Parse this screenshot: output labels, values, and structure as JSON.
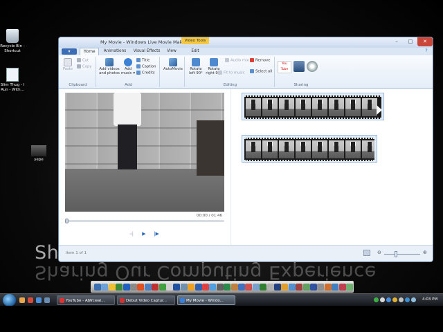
{
  "desktop": {
    "wallpaper_text": "Sharing Our Computing Experience",
    "icons": [
      {
        "label": "Recycle Bin - Shortcut"
      },
      {
        "label": "Slim Thug - I Run - With..."
      },
      {
        "label": "yepe"
      }
    ]
  },
  "window": {
    "title": "My Movie - Windows Live Movie Maker",
    "contextual_tab": "Video Tools",
    "controls": {
      "minimize": "–",
      "maximize": "□",
      "close": "✕"
    },
    "tabs": [
      {
        "label": "Home"
      },
      {
        "label": "Animations"
      },
      {
        "label": "Visual Effects"
      },
      {
        "label": "View"
      },
      {
        "label": "Edit"
      }
    ],
    "help": "?"
  },
  "ribbon": {
    "clipboard": {
      "label": "Clipboard",
      "paste": "Paste",
      "cut": "Cut",
      "copy": "Copy"
    },
    "add": {
      "label": "Add",
      "add_videos": "Add videos and photos",
      "add_music": "Add music ▾",
      "title": "Title",
      "caption": "Caption",
      "credits": "Credits"
    },
    "automovie": {
      "label": "AutoMovie"
    },
    "editing": {
      "label": "Editing",
      "rotate_left": "Rotate left 90°",
      "rotate_right": "Rotate right 90°",
      "audio_mix": "Audio mix",
      "fit_to_music": "Fit to music",
      "remove": "Remove",
      "select_all": "Select all"
    },
    "sharing": {
      "label": "Sharing",
      "youtube": "You Tube"
    }
  },
  "player": {
    "timecode": "00:00 / 01:46",
    "progress": 0
  },
  "status": {
    "item_text": "Item 1 of 1"
  },
  "taskbar": {
    "tasks": [
      {
        "label": "YouTube - AJWcwal...",
        "color": "#d33"
      },
      {
        "label": "Debut Video Captur...",
        "color": "#c33"
      },
      {
        "label": "My Movie - Windo...",
        "color": "#3a7fd5"
      }
    ],
    "clock": "4:03 PM"
  }
}
